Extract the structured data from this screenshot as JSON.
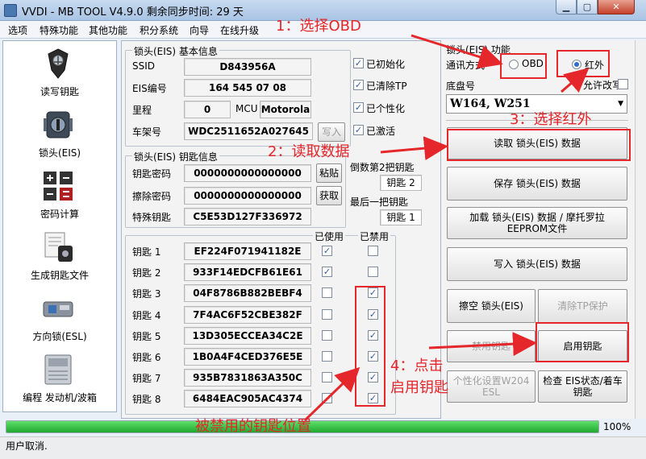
{
  "window": {
    "title": "VVDI - MB TOOL V4.9.0   剩余同步时间: 29 天",
    "min_icon": "minimize-icon",
    "max_icon": "maximize-icon",
    "close_icon": "close-icon"
  },
  "menu": [
    "选项",
    "特殊功能",
    "其他功能",
    "积分系统",
    "向导",
    "在线升级"
  ],
  "sidebar": [
    {
      "label": "读写钥匙",
      "icon": "key-icon"
    },
    {
      "label": "锁头(EIS)",
      "icon": "eis-icon"
    },
    {
      "label": "密码计算",
      "icon": "calculator-icon"
    },
    {
      "label": "生成钥匙文件",
      "icon": "key-file-icon"
    },
    {
      "label": "方向锁(ESL)",
      "icon": "esl-icon"
    },
    {
      "label": "编程 发动机/波箱",
      "icon": "ecu-icon"
    }
  ],
  "eis_info": {
    "title": "锁头(EIS) 基本信息",
    "ssid_label": "SSID",
    "ssid": "D843956A",
    "eis_no_label": "EIS编号",
    "eis_no": "164 545 07 08",
    "mileage_label": "里程",
    "mileage": "0",
    "mcu_label": "MCU",
    "mcu": "Motorola",
    "vin_label": "车架号",
    "vin": "WDC2511652A027645",
    "write_button": "写入",
    "checks": [
      {
        "label": "已初始化",
        "checked": true
      },
      {
        "label": "已清除TP",
        "checked": true
      },
      {
        "label": "已个性化",
        "checked": true
      },
      {
        "label": "已激活",
        "checked": true
      }
    ]
  },
  "key_info": {
    "title": "锁头(EIS) 钥匙信息",
    "key_password_label": "钥匙密码",
    "key_password": "0000000000000000",
    "paste_button": "粘贴",
    "erase_password_label": "擦除密码",
    "erase_password": "0000000000000000",
    "get_button": "获取",
    "special_key_label": "特殊钥匙",
    "special_key": "C5E53D127F336972",
    "second_last_label": "倒数第2把钥匙",
    "second_last_value": "钥匙 2",
    "last_label": "最后一把钥匙",
    "last_value": "钥匙 1"
  },
  "keys": {
    "used_header": "已使用",
    "disabled_header": "已禁用",
    "rows": [
      {
        "label": "钥匙 1",
        "value": "EF224F071941182E",
        "used": true,
        "disabled": false
      },
      {
        "label": "钥匙 2",
        "value": "933F14EDCFB61E61",
        "used": true,
        "disabled": false
      },
      {
        "label": "钥匙 3",
        "value": "04F8786B882BEBF4",
        "used": false,
        "disabled": true
      },
      {
        "label": "钥匙 4",
        "value": "7F4AC6F52CBE382F",
        "used": false,
        "disabled": true
      },
      {
        "label": "钥匙 5",
        "value": "13D305ECCEA34C2E",
        "used": false,
        "disabled": true
      },
      {
        "label": "钥匙 6",
        "value": "1B0A4F4CED376E5E",
        "used": false,
        "disabled": true
      },
      {
        "label": "钥匙 7",
        "value": "935B7831863A350C",
        "used": false,
        "disabled": true
      },
      {
        "label": "钥匙 8",
        "value": "6484EAC905AC4374",
        "used": false,
        "disabled": true
      }
    ]
  },
  "right": {
    "title": "锁头(EIS) 功能",
    "comm_label": "通讯方式",
    "radio_obd": "OBD",
    "radio_ir": "红外",
    "chassis_label": "底盘号",
    "allow_edit": "允许改写",
    "chassis_value": "W164, W251",
    "read_button": "读取 锁头(EIS) 数据",
    "save_button": "保存 锁头(EIS) 数据",
    "load_button": "加载 锁头(EIS) 数据 / 摩托罗拉EEPROM文件",
    "write_button": "写入 锁头(EIS) 数据",
    "erase_button": "擦空 锁头(EIS)",
    "clear_tp_button": "清除TP保护",
    "disable_key_button": "禁用钥匙",
    "enable_key_button": "启用钥匙",
    "personalize_button": "个性化设置W204 ESL",
    "check_button": "检查 EIS状态/着车钥匙"
  },
  "progress": {
    "percent": 100,
    "text": "100%"
  },
  "status": "用户取消.",
  "annotations": {
    "step1": "1：选择OBD",
    "step2": "2：读取数据",
    "step3": "3：选择红外",
    "step4_line1": "4：点击",
    "step4_line2": "启用钥匙",
    "disabled_note": "被禁用的钥匙位置",
    "color": "#e5262a"
  }
}
